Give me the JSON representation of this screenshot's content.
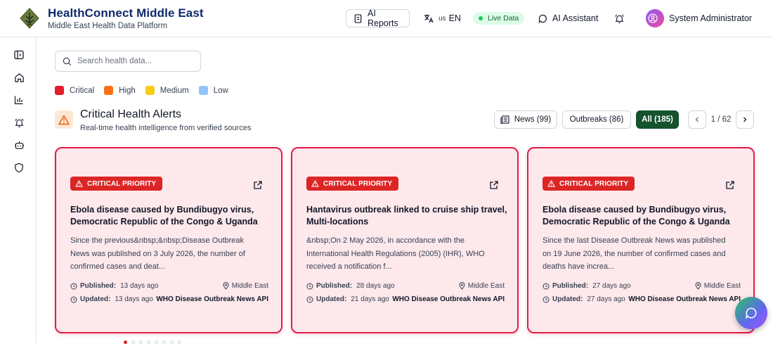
{
  "header": {
    "title": "HealthConnect Middle East",
    "subtitle": "Middle East Health Data Platform",
    "ai_reports": "AI Reports",
    "lang_flag": "us",
    "lang_code": "EN",
    "live_data": "Live Data",
    "ai_assistant": "AI Assistant",
    "user_name": "System Administrator"
  },
  "sidebar": {
    "icons": [
      "panel-toggle-icon",
      "home-icon",
      "bar-chart-icon",
      "bell-icon",
      "bot-icon",
      "shield-icon"
    ]
  },
  "search": {
    "placeholder": "Search health data..."
  },
  "legend": [
    {
      "label": "Critical",
      "color": "#e11d2e"
    },
    {
      "label": "High",
      "color": "#f97316"
    },
    {
      "label": "Medium",
      "color": "#facc15"
    },
    {
      "label": "Low",
      "color": "#93c5fd"
    }
  ],
  "section": {
    "title": "Critical Health Alerts",
    "subtitle": "Real-time health intelligence from verified sources"
  },
  "filters": {
    "news": "News (99)",
    "outbreaks": "Outbreaks (86)",
    "all": "All (185)"
  },
  "pager": {
    "text": "1 / 62"
  },
  "cards": [
    {
      "badge": "CRITICAL PRIORITY",
      "title": "Ebola disease caused by Bundibugyo virus, Democratic Republic of the Congo & Uganda",
      "description": "Since the previous&nbsp;&nbsp;Disease Outbreak News was published on 3 July 2026, the number of confirmed cases and deat...",
      "published_label": "Published:",
      "published": "13 days ago",
      "location": "Middle East",
      "updated_label": "Updated:",
      "updated": "13 days ago",
      "source": "WHO Disease Outbreak News API"
    },
    {
      "badge": "CRITICAL PRIORITY",
      "title": "Hantavirus outbreak linked to cruise ship travel, Multi-locations",
      "description": "&nbsp;On 2 May 2026, in accordance with the International Health Regulations (2005) (IHR), WHO received a notification f...",
      "published_label": "Published:",
      "published": "28 days ago",
      "location": "Middle East",
      "updated_label": "Updated:",
      "updated": "21 days ago",
      "source": "WHO Disease Outbreak News API"
    },
    {
      "badge": "CRITICAL PRIORITY",
      "title": "Ebola disease caused by Bundibugyo virus, Democratic Republic of the Congo & Uganda",
      "description": "Since the last Disease Outbreak News was published on 19 June 2026, the number of confirmed cases and deaths have increa...",
      "published_label": "Published:",
      "published": "27 days ago",
      "location": "Middle East",
      "updated_label": "Updated:",
      "updated": "27 days ago",
      "source": "WHO Disease Outbreak News API"
    }
  ],
  "colors": {
    "brand": "#0f2a6b",
    "critical_badge": "#dc2626",
    "card_border": "#e11d48",
    "card_bg": "#fde8ec",
    "active_filter": "#14532d",
    "live_bg": "#dcfce7"
  }
}
